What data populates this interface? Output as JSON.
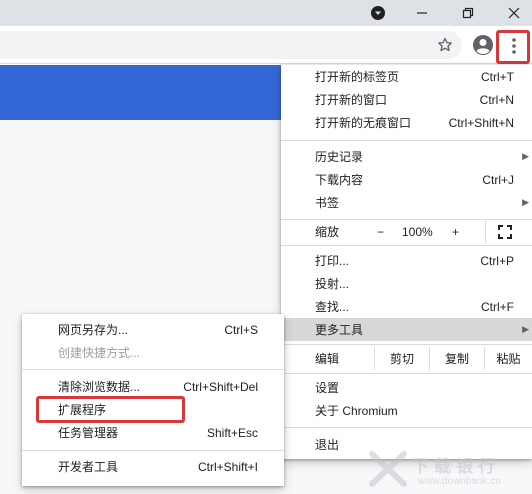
{
  "main_menu": {
    "new_tab": {
      "label": "打开新的标签页",
      "shortcut": "Ctrl+T"
    },
    "new_window": {
      "label": "打开新的窗口",
      "shortcut": "Ctrl+N"
    },
    "new_incognito": {
      "label": "打开新的无痕窗口",
      "shortcut": "Ctrl+Shift+N"
    },
    "history": {
      "label": "历史记录"
    },
    "downloads": {
      "label": "下载内容",
      "shortcut": "Ctrl+J"
    },
    "bookmarks": {
      "label": "书签"
    },
    "zoom": {
      "label": "缩放",
      "minus": "−",
      "value": "100%",
      "plus": "+"
    },
    "print": {
      "label": "打印...",
      "shortcut": "Ctrl+P"
    },
    "cast": {
      "label": "投射..."
    },
    "find": {
      "label": "查找...",
      "shortcut": "Ctrl+F"
    },
    "more_tools": {
      "label": "更多工具"
    },
    "edit": {
      "label": "编辑",
      "cut": "剪切",
      "copy": "复制",
      "paste": "粘贴"
    },
    "settings": {
      "label": "设置"
    },
    "about": {
      "label": "关于 Chromium"
    },
    "exit": {
      "label": "退出"
    }
  },
  "sub_menu": {
    "save_page": {
      "label": "网页另存为...",
      "shortcut": "Ctrl+S"
    },
    "create_shortcut": {
      "label": "创建快捷方式..."
    },
    "clear_data": {
      "label": "清除浏览数据...",
      "shortcut": "Ctrl+Shift+Del"
    },
    "extensions": {
      "label": "扩展程序"
    },
    "task_manager": {
      "label": "任务管理器",
      "shortcut": "Shift+Esc"
    },
    "dev_tools": {
      "label": "开发者工具",
      "shortcut": "Ctrl+Shift+I"
    }
  },
  "watermark": {
    "title": "下载银行",
    "url": "www.downbank.cn"
  },
  "colors": {
    "accent_blue": "#3367d6",
    "highlight_red": "#d9383a",
    "active_row": "#d8d8d8"
  }
}
